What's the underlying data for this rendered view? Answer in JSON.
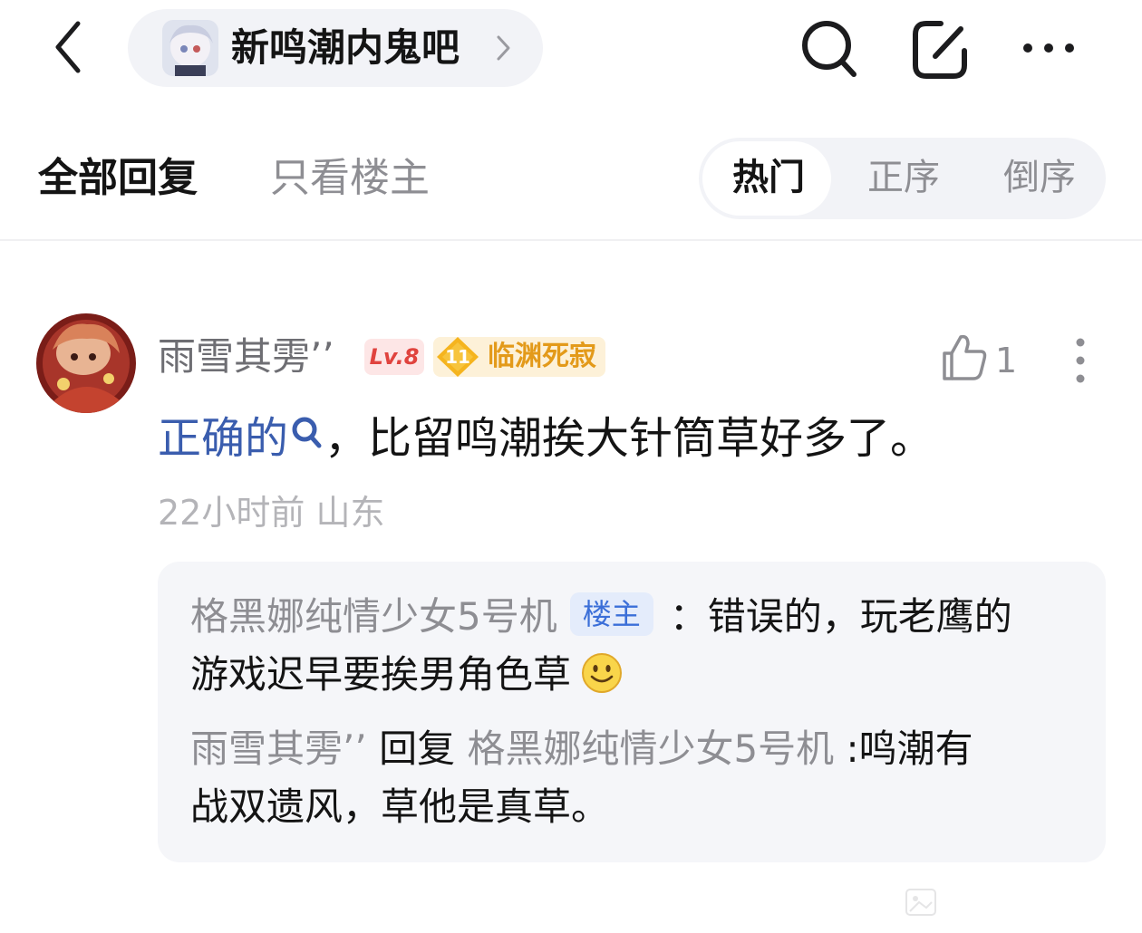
{
  "nav": {
    "forum_name": "新鸣潮内鬼吧"
  },
  "tabs": {
    "all_replies": "全部回复",
    "op_only": "只看楼主"
  },
  "sort": {
    "hot": "热门",
    "asc": "正序",
    "desc": "倒序"
  },
  "comment": {
    "author": "雨雪其雱’’",
    "level": "Lv.8",
    "rank_number": "11",
    "rank_title": "临渊死寂",
    "like_count": "1",
    "keyword": "正确的",
    "text": "，比留鸣潮挨大针筒草好多了。",
    "time": "22小时前",
    "location": "山东"
  },
  "replies": [
    {
      "author": "格黑娜纯情少女5号机",
      "tag": "楼主",
      "text_line1": "：错误的，玩老鹰的",
      "text_line2": "游戏迟早要挨男角色草"
    },
    {
      "author": "雨雪其雱’’",
      "reply_word": "回复",
      "target": "格黑娜纯情少女5号机",
      "text_line1": ":鸣潮有",
      "text_line2": "战双遗风，草他是真草。"
    }
  ],
  "icons": {
    "back": "chevron-left-icon",
    "search": "search-icon",
    "edit": "edit-icon",
    "more": "more-horizontal-icon",
    "like": "thumbs-up-icon",
    "comment_more": "more-vertical-icon",
    "keyword": "search-icon",
    "emoji": "smile-emoji-icon"
  },
  "colors": {
    "keyword_link": "#3a5dae",
    "level_badge": "#e0433e",
    "rank_badge": "#e39a1a",
    "op_tag": "#3b6fd8",
    "reply_background": "#f5f6f9"
  }
}
